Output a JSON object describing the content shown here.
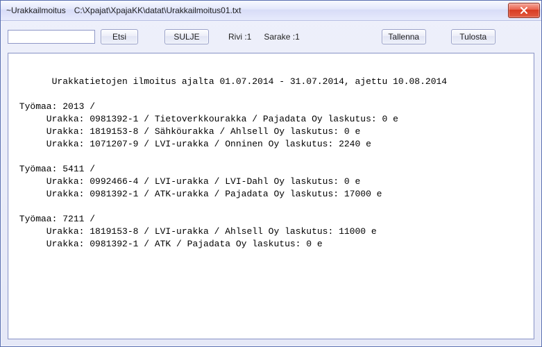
{
  "window": {
    "title_prefix": "~Urakkailmoitus",
    "title_path": "C:\\Xpajat\\XpajaKK\\datat\\Urakkailmoitus01.txt"
  },
  "toolbar": {
    "search_value": "",
    "search_placeholder": "",
    "etsi_label": "Etsi",
    "sulje_label": "SULJE",
    "status_rivi_label": "Rivi :",
    "status_rivi_value": "1",
    "status_sarake_label": "Sarake :",
    "status_sarake_value": "1",
    "tallenna_label": "Tallenna",
    "tulosta_label": "Tulosta"
  },
  "document": {
    "header": "Urakkatietojen ilmoitus ajalta 01.07.2014 - 31.07.2014, ajettu 10.08.2014",
    "sites": [
      {
        "label": "Työmaa: 2013 /",
        "rows": [
          "Urakka: 0981392-1 / Tietoverkkourakka / Pajadata Oy laskutus: 0 e",
          "Urakka: 1819153-8 / Sähköurakka / Ahlsell Oy laskutus: 0 e",
          "Urakka: 1071207-9 / LVI-urakka / Onninen Oy laskutus: 2240 e"
        ]
      },
      {
        "label": "Työmaa: 5411 /",
        "rows": [
          "Urakka: 0992466-4 / LVI-urakka / LVI-Dahl Oy laskutus: 0 e",
          "Urakka: 0981392-1 / ATK-urakka / Pajadata Oy laskutus: 17000 e"
        ]
      },
      {
        "label": "Työmaa: 7211 /",
        "rows": [
          "Urakka: 1819153-8 / LVI-urakka / Ahlsell Oy laskutus: 11000 e",
          "Urakka: 0981392-1 / ATK / Pajadata Oy laskutus: 0 e"
        ]
      }
    ]
  }
}
